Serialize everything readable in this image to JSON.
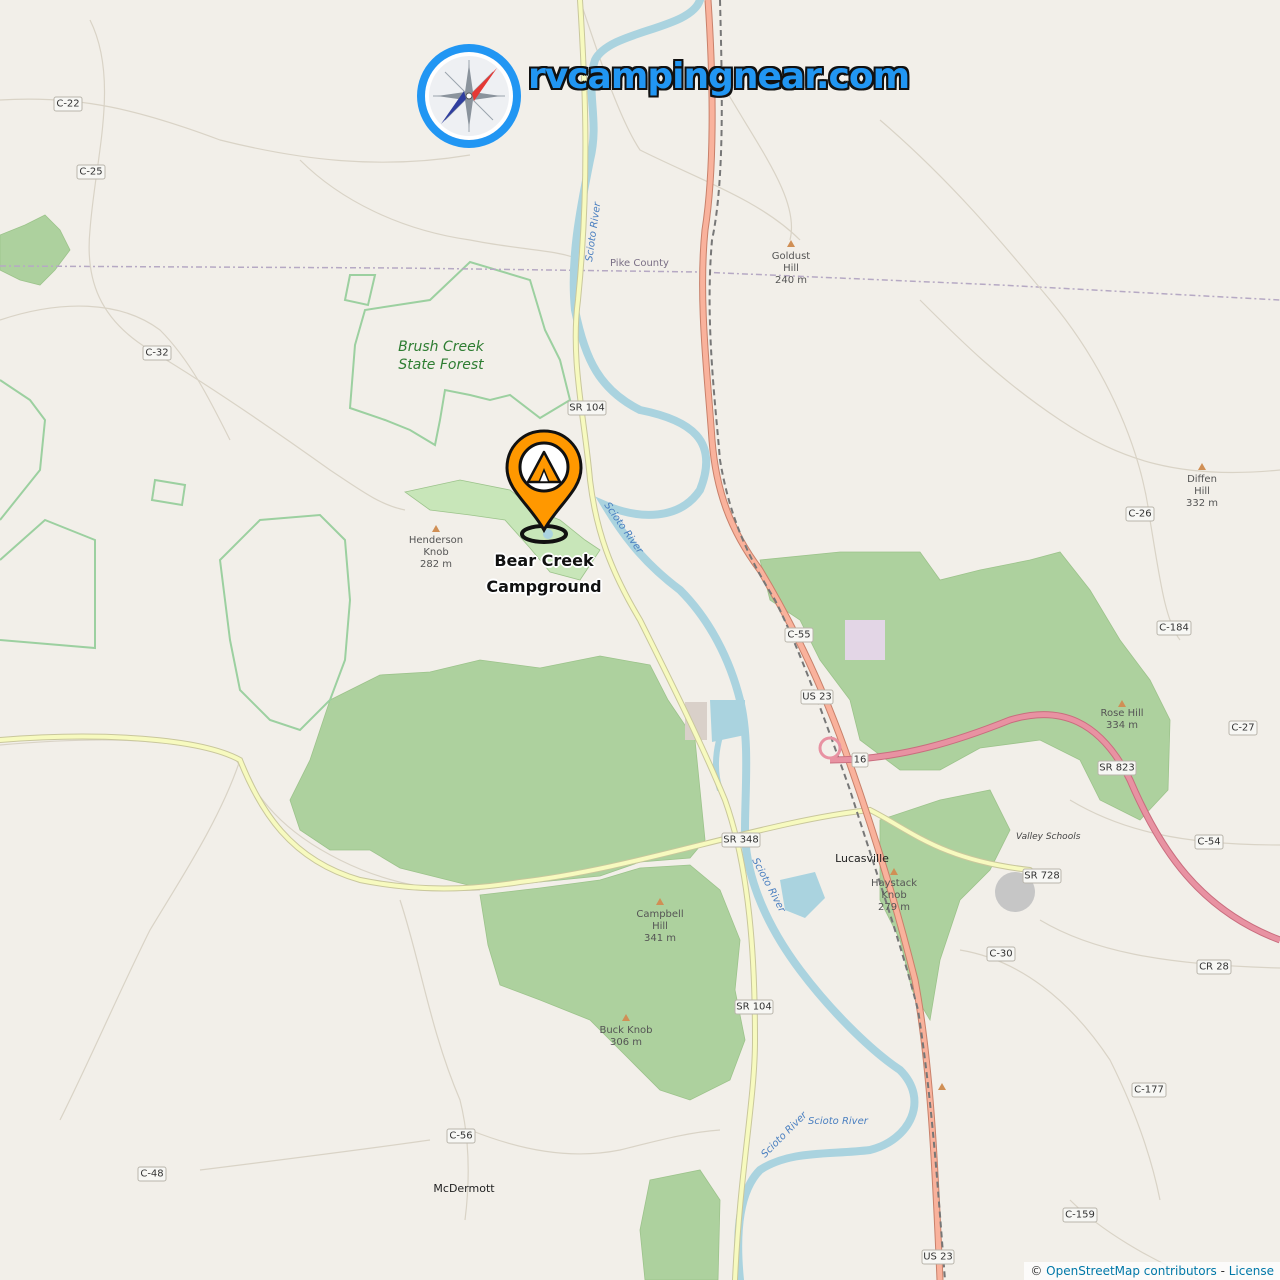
{
  "brand": {
    "logo_text": "rvcampingnear.com"
  },
  "campground": {
    "name": "Bear Creek Campground",
    "icon": "tent-pin-icon",
    "pin_color": "#ff9800"
  },
  "map_labels": {
    "brush_creek_line1": "Brush Creek",
    "brush_creek_line2": "State Forest",
    "pike_county": "Pike County",
    "scioto_river": "Scioto River",
    "lucasville": "Lucasville",
    "mcdermott": "McDermott",
    "valley_schools": "Valley Schools"
  },
  "peaks": {
    "goldust": [
      "Goldust",
      "Hill",
      "240 m"
    ],
    "diffen": [
      "Diffen",
      "Hill",
      "332 m"
    ],
    "henderson": [
      "Henderson",
      "Knob",
      "282 m"
    ],
    "rose": [
      "Rose Hill",
      "334 m"
    ],
    "haystack": [
      "Haystack",
      "Knob",
      "279 m"
    ],
    "campbell": [
      "Campbell",
      "Hill",
      "341 m"
    ],
    "buck": [
      "Buck Knob",
      "306 m"
    ]
  },
  "shields": {
    "c22": "C-22",
    "c25": "C-25",
    "c32": "C-32",
    "sr104a": "SR 104",
    "c26": "C-26",
    "c184": "C-184",
    "c55": "C-55",
    "us23a": "US 23",
    "c27": "C-27",
    "sr823": "SR 823",
    "sr348": "SR 348",
    "c54": "C-54",
    "sr728": "SR 728",
    "c30": "C-30",
    "cr28": "CR 28",
    "sr104b": "SR 104",
    "c177": "C-177",
    "c56": "C-56",
    "c48": "C-48",
    "c159": "C-159",
    "us23b": "US 23",
    "r16": "16"
  },
  "attribution": {
    "prefix": "© ",
    "osm": "OpenStreetMap contributors",
    "sep": " - ",
    "license": "License"
  },
  "colors": {
    "background": "#f2efe9",
    "forest": "#add19e",
    "water": "#aad3df",
    "motorway": "#e892a2",
    "trunk": "#f9b29c",
    "secondary": "#f7fabf",
    "brand": "#2196f3"
  }
}
